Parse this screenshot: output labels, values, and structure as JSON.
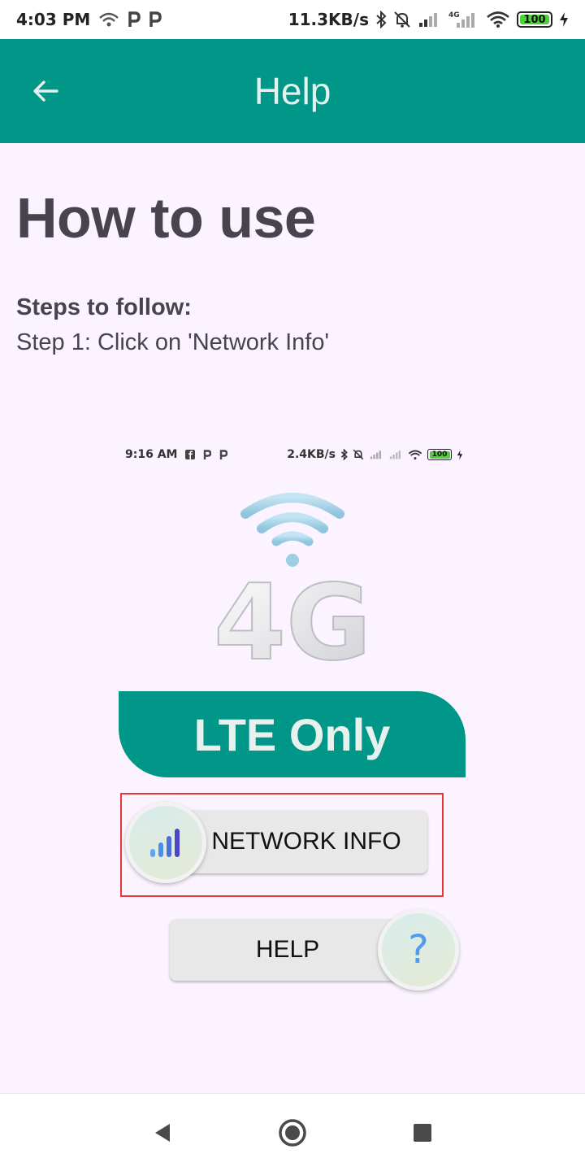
{
  "status_bar": {
    "time": "4:03 PM",
    "speed": "11.3KB/s",
    "battery": "100",
    "icons": [
      "hotspot-icon",
      "parking-icon",
      "parking-icon",
      "bluetooth-icon",
      "alarm-off-icon",
      "signal-icon",
      "4g-signal-icon",
      "wifi-icon",
      "battery-icon",
      "charging-icon"
    ]
  },
  "app_bar": {
    "title": "Help",
    "back_icon": "back-arrow-icon"
  },
  "content": {
    "heading": "How to use",
    "steps_title": "Steps to follow:",
    "step_1": "Step 1: Click on 'Network Info'"
  },
  "illustration": {
    "status_time": "9:16 AM",
    "status_speed": "2.4KB/s",
    "status_battery": "100",
    "network_label": "4G",
    "banner": "LTE Only",
    "network_button": "NETWORK INFO",
    "help_button": "HELP",
    "help_symbol": "?",
    "highlight_color": "#e53935"
  },
  "nav_bar": {
    "back_icon": "nav-back-icon",
    "home_icon": "nav-home-icon",
    "recents_icon": "nav-recents-icon"
  },
  "colors": {
    "primary": "#009688",
    "background": "#FBF3FF",
    "text": "#47444d"
  }
}
